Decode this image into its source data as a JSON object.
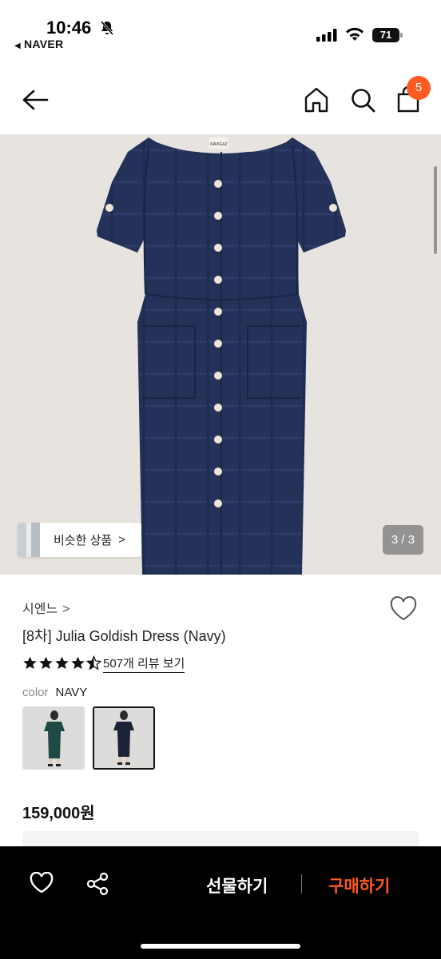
{
  "status_bar": {
    "time": "10:46",
    "back_app": "NAVER",
    "battery": "71"
  },
  "header": {
    "cart_count": "5"
  },
  "gallery": {
    "similar_label": "비슷한 상품",
    "similar_chevron": ">",
    "page_counter": "3 / 3",
    "label_tag": "NAVIGAZ"
  },
  "product": {
    "brand": "시엔느",
    "brand_chevron": ">",
    "title": "[8차] Julia Goldish Dress (Navy)",
    "rating": 4.5,
    "rating_max": 5,
    "reviews_link": "507개 리뷰 보기",
    "color_label": "color",
    "color_value": "NAVY",
    "swatches": [
      "teal",
      "navy"
    ],
    "price": "159,000원"
  },
  "bottom_bar": {
    "gift_label": "선물하기",
    "buy_label": "구매하기"
  },
  "colors": {
    "accent": "#ff5a1f",
    "dress_navy": "#243159",
    "hero_bg": "#e7e3de"
  },
  "icons": {
    "back": "arrow-left-icon",
    "home": "home-icon",
    "search": "search-icon",
    "cart": "shopping-bag-icon",
    "wish": "heart-icon",
    "share": "share-icon"
  }
}
